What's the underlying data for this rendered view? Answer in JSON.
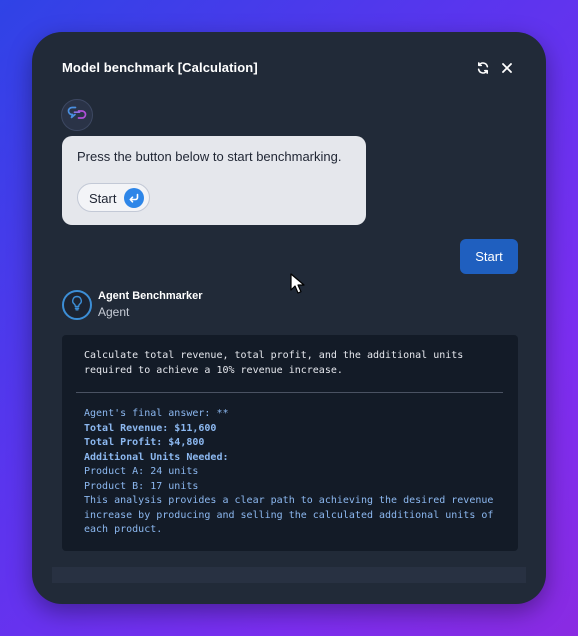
{
  "window": {
    "title": "Model benchmark [Calculation]",
    "refresh_icon": "refresh-icon",
    "close_icon": "close-icon"
  },
  "bot_message": {
    "avatar_icon": "chat-link-icon",
    "text": "Press the button below to start benchmarking.",
    "start_button_label": "Start",
    "start_button_icon": "enter-return-icon"
  },
  "user_message": {
    "text": "Start"
  },
  "agent": {
    "avatar_icon": "lightbulb-icon",
    "name": "Agent Benchmarker",
    "role": "Agent"
  },
  "result": {
    "task": "Calculate total revenue, total profit, and the additional units required to achieve a 10% revenue increase.",
    "answer_intro": "Agent's final answer: **",
    "total_revenue": "Total Revenue: $11,600",
    "total_profit": "Total Profit: $4,800",
    "additional_units_heading": "Additional Units Needed:",
    "product_a": "Product A: 24 units",
    "product_b": "Product B: 17 units",
    "summary": "This analysis provides a clear path to achieving the desired revenue increase by producing and selling the calculated additional units of each product."
  },
  "colors": {
    "panel": "#212a38",
    "user_bubble": "#1f5fbf",
    "accent_blue": "#2e86e8",
    "answer_text": "#8cb8f0"
  }
}
